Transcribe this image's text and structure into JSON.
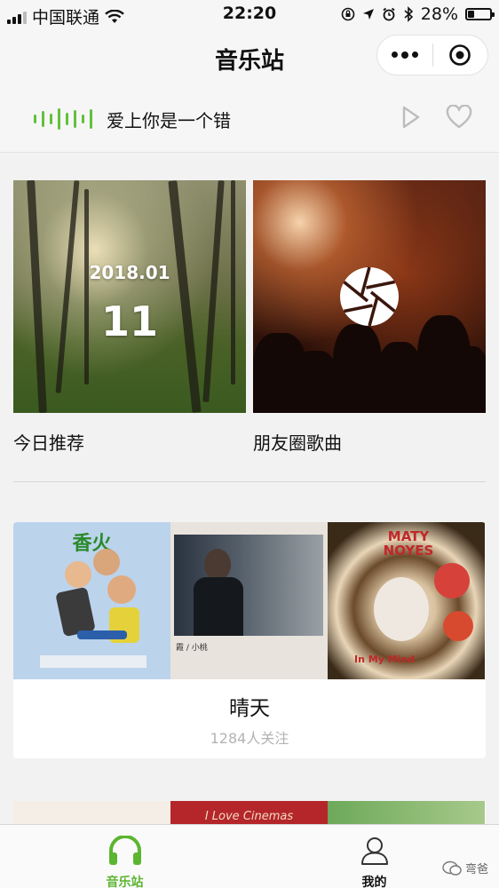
{
  "status_bar": {
    "carrier": "中国联通",
    "time": "22:20",
    "battery": "28%",
    "battery_level": 0.28
  },
  "nav": {
    "title": "音乐站",
    "more_icon": "more-dots-icon",
    "close_icon": "target-circle-icon"
  },
  "now_playing": {
    "song": "爱上你是一个错",
    "wave_color": "#61c13b",
    "play_icon": "play-icon",
    "like_icon": "heart-icon"
  },
  "cards": [
    {
      "label": "今日推荐",
      "date": "2018.01",
      "day": "11"
    },
    {
      "label": "朋友圈歌曲",
      "icon": "camera-shutter-icon"
    }
  ],
  "playlist": {
    "name": "晴天",
    "followers": "1284人关注",
    "covers": [
      {
        "title": "香火"
      },
      {
        "caption": "霞 / 小桃"
      },
      {
        "title": "MATY NOYES",
        "subtitle": "In My Mind"
      }
    ]
  },
  "peek_cover_texts": [
    "I Love Cinemas"
  ],
  "tabbar": {
    "tabs": [
      {
        "label": "音乐站",
        "icon": "headphones-icon",
        "active": true
      },
      {
        "label": "我的",
        "icon": "person-icon",
        "active": false
      }
    ],
    "accent": "#5cb531"
  },
  "watermark": "弯爸"
}
